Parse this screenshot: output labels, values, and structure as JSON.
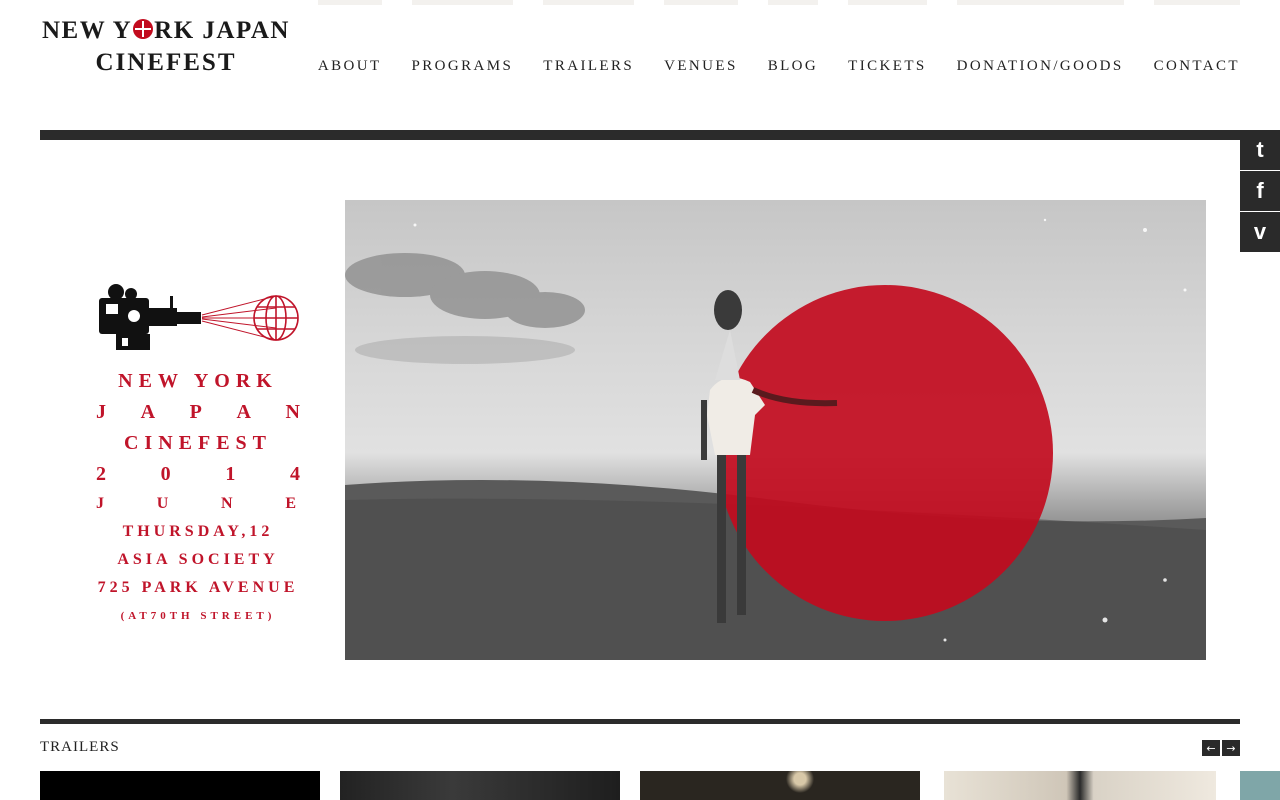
{
  "logo": {
    "line1_prefix": "NEW Y",
    "line1_suffix": "RK JAPAN",
    "line2": "CINEFEST"
  },
  "nav": {
    "items": [
      {
        "label": "ABOUT"
      },
      {
        "label": "PROGRAMS"
      },
      {
        "label": "TRAILERS"
      },
      {
        "label": "VENUES"
      },
      {
        "label": "BLOG"
      },
      {
        "label": "TICKETS"
      },
      {
        "label": "DONATION/GOODS"
      },
      {
        "label": "CONTACT"
      }
    ]
  },
  "social": {
    "twitter": {
      "icon": "twitter-icon",
      "glyph": "t"
    },
    "facebook": {
      "icon": "facebook-icon",
      "glyph": "f"
    },
    "vimeo": {
      "icon": "vimeo-icon",
      "glyph": "v"
    }
  },
  "poster": {
    "line1": "NEW YORK",
    "line2": [
      "J",
      "A",
      "P",
      "A",
      "N"
    ],
    "line3": "CINEFEST",
    "line4": [
      "2",
      "0",
      "1",
      "4"
    ],
    "line5": [
      "J",
      "U",
      "N",
      "E"
    ],
    "line6": "THURSDAY,12",
    "line7": "ASIA SOCIETY",
    "line8": "725 PARK AVENUE",
    "line9": "(AT70TH STREET)"
  },
  "trailers": {
    "title": "TRAILERS",
    "prev": "←",
    "next": "→"
  },
  "colors": {
    "accent_red": "#c20b1e",
    "bar_dark": "#2b2b2b"
  }
}
